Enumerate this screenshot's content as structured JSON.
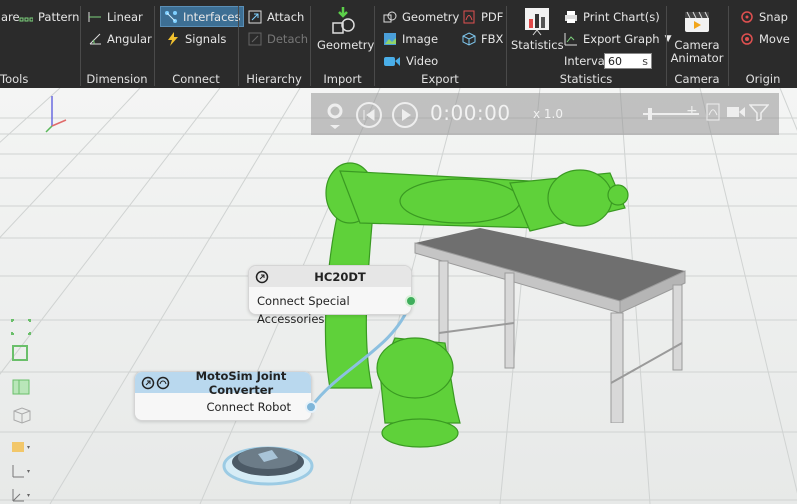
{
  "ribbon": {
    "tools": {
      "partial_item": "are",
      "pattern": "Pattern",
      "label": "Tools"
    },
    "dimension": {
      "linear": "Linear",
      "angular": "Angular",
      "label": "Dimension"
    },
    "connect": {
      "interfaces": "Interfaces",
      "signals": "Signals",
      "label": "Connect"
    },
    "hierarchy": {
      "attach": "Attach",
      "detach": "Detach",
      "label": "Hierarchy"
    },
    "import": {
      "geometry": "Geometry",
      "label": "Import"
    },
    "export": {
      "geometry": "Geometry",
      "image": "Image",
      "video": "Video",
      "pdf": "PDF",
      "fbx": "FBX",
      "label": "Export"
    },
    "statistics": {
      "statistics": "Statistics",
      "print_chart": "Print Chart(s)",
      "export_graph": "Export Graph",
      "interval_label": "Interval",
      "interval_value": "60",
      "interval_unit": "s",
      "label": "Statistics"
    },
    "camera": {
      "line1": "Camera",
      "line2": "Animator",
      "label": "Camera"
    },
    "origin": {
      "snap": "Snap",
      "move": "Move",
      "label": "Origin"
    }
  },
  "playback": {
    "time": "0:00:00",
    "speed": "x 1.0"
  },
  "nodes": {
    "robot": {
      "title": "HC20DT",
      "port": "Connect Special Accessories"
    },
    "converter": {
      "title": "MotoSim Joint Converter",
      "port": "Connect Robot"
    }
  },
  "colors": {
    "ribbon_bg": "#2b2b2b",
    "active_blue": "#3d6f94",
    "robot_green": "#5fd13a",
    "node_header_blue": "#b9d8ee",
    "port_green": "#3fae5c",
    "port_blue": "#7fb6d9"
  }
}
